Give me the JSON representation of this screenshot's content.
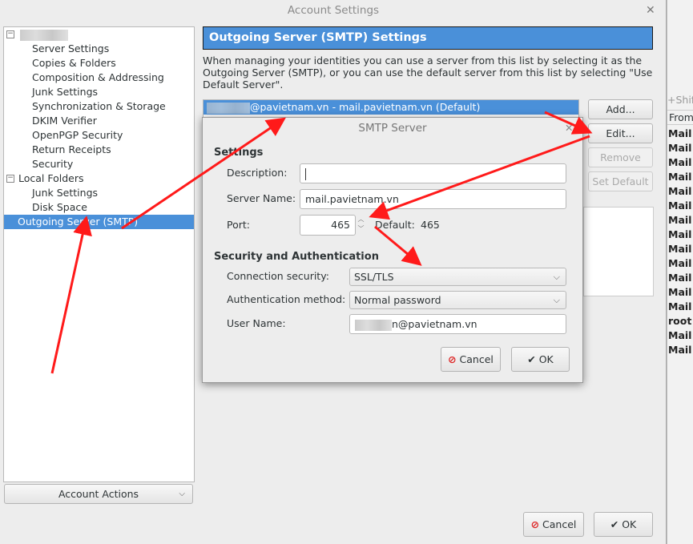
{
  "window": {
    "title": "Account Settings",
    "close_icon": "close-icon"
  },
  "tree": {
    "items": [
      {
        "label": "Server Settings"
      },
      {
        "label": "Copies & Folders"
      },
      {
        "label": "Composition & Addressing"
      },
      {
        "label": "Junk Settings"
      },
      {
        "label": "Synchronization & Storage"
      },
      {
        "label": "DKIM Verifier"
      },
      {
        "label": "OpenPGP Security"
      },
      {
        "label": "Return Receipts"
      },
      {
        "label": "Security"
      }
    ],
    "local_folders": "Local Folders",
    "local_items": [
      {
        "label": "Junk Settings"
      },
      {
        "label": "Disk Space"
      }
    ],
    "outgoing": "Outgoing Server (SMTP)"
  },
  "account_actions": "Account Actions",
  "panel": {
    "title": "Outgoing Server (SMTP) Settings",
    "description": "When managing your identities you can use a server from this list by selecting it as the Outgoing Server (SMTP), or you can use the default server from this list by selecting \"Use Default Server\".",
    "server_entry": "@pavietnam.vn - mail.pavietnam.vn (Default)",
    "buttons": {
      "add": "Add...",
      "edit": "Edit...",
      "remove": "Remove",
      "set_default": "Set Default"
    }
  },
  "footer": {
    "cancel": "Cancel",
    "ok": "OK"
  },
  "smtp_dialog": {
    "title": "SMTP Server",
    "settings_heading": "Settings",
    "description_label": "Description:",
    "description_value": "",
    "server_name_label": "Server Name:",
    "server_name_value": "mail.pavietnam.vn",
    "port_label": "Port:",
    "port_value": "465",
    "default_label": "Default:",
    "default_value": "465",
    "security_heading": "Security and Authentication",
    "connection_security_label": "Connection security:",
    "connection_security_value": "SSL/TLS",
    "auth_method_label": "Authentication method:",
    "auth_method_value": "Normal password",
    "user_name_label": "User Name:",
    "user_name_value": "n@pavietnam.vn",
    "cancel": "Cancel",
    "ok": "OK"
  },
  "background_window": {
    "shortcut_fragment": "+Shift",
    "column_from": "From",
    "rows": [
      "Mail",
      "Mail",
      "Mail",
      "Mail",
      "Mail",
      "Mail",
      "Mail",
      "Mail",
      "Mail",
      "Mail",
      "Mail",
      "Mail",
      "Mail",
      "root",
      "Mail",
      "Mail"
    ]
  },
  "annotation_color": "#ff1a1a"
}
